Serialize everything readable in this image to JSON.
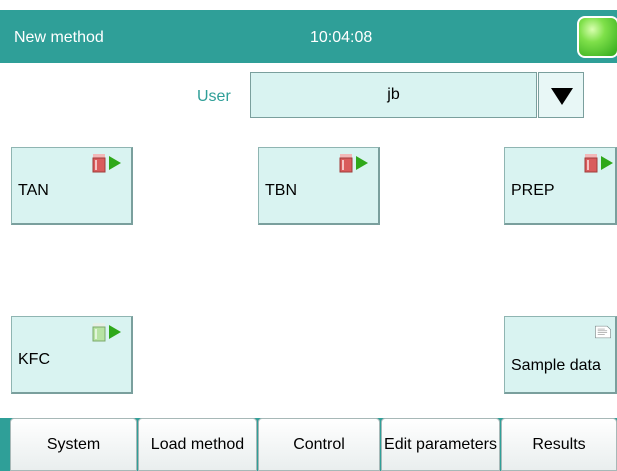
{
  "header": {
    "title": "New method",
    "time": "10:04:08"
  },
  "user": {
    "label": "User",
    "value": "jb"
  },
  "tiles": [
    {
      "label": "TAN",
      "icon": "beaker-red-play-icon"
    },
    {
      "label": "TBN",
      "icon": "beaker-red-play-icon"
    },
    {
      "label": "PREP",
      "icon": "beaker-red-play-icon"
    },
    {
      "label": "KFC",
      "icon": "beaker-green-play-icon"
    },
    {
      "label": "Sample data",
      "icon": "document-icon"
    }
  ],
  "toolbar": {
    "system": "System",
    "load_method": "Load method",
    "control": "Control",
    "edit_parameters": "Edit parameters",
    "results": "Results"
  },
  "colors": {
    "accent": "#2f9f98",
    "tile_bg": "#d9f3f1",
    "status_green": "#4fcf2a"
  }
}
